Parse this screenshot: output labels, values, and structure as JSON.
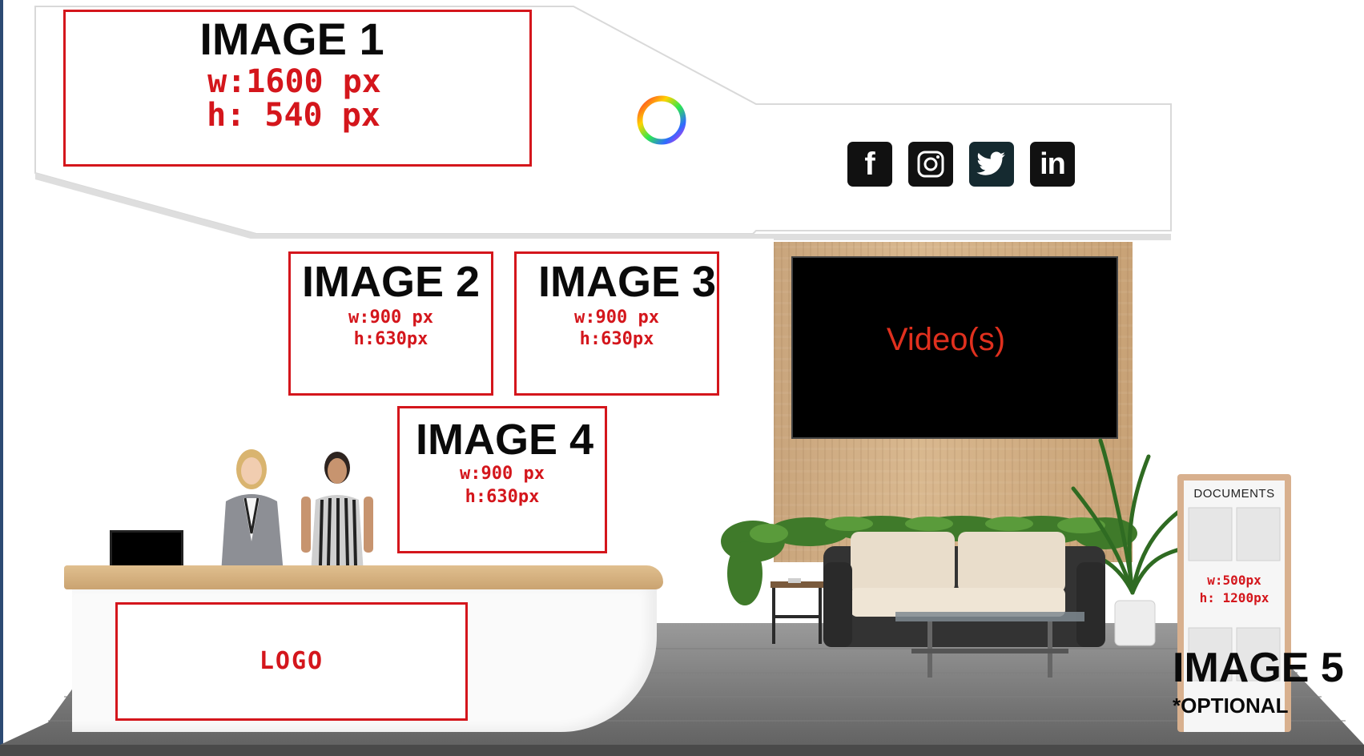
{
  "slots": {
    "image1": {
      "title": "IMAGE 1",
      "w": "w:1600 px",
      "h": "h: 540 px"
    },
    "image2": {
      "title": "IMAGE 2",
      "w": "w:900 px",
      "h": "h:630px"
    },
    "image3": {
      "title": "IMAGE 3",
      "w": "w:900 px",
      "h": "h:630px"
    },
    "image4": {
      "title": "IMAGE 4",
      "w": "w:900 px",
      "h": "h:630px"
    },
    "logo": {
      "title": "LOGO"
    }
  },
  "video": {
    "label": "Video(s)"
  },
  "social": [
    {
      "label": "f",
      "icon": "facebook-icon"
    },
    {
      "label": "◎",
      "icon": "instagram-icon"
    },
    {
      "label": "🐦",
      "icon": "twitter-icon"
    },
    {
      "label": "in",
      "icon": "linkedin-icon"
    }
  ],
  "documents": {
    "title": "DOCUMENTS",
    "w": "w:500px",
    "h": "h: 1200px"
  },
  "image5": {
    "title": "IMAGE 5",
    "note": "*OPTIONAL"
  },
  "colors": {
    "accent": "#d4161c",
    "ink": "#0a0a0a",
    "wood": "#c9a57c"
  }
}
